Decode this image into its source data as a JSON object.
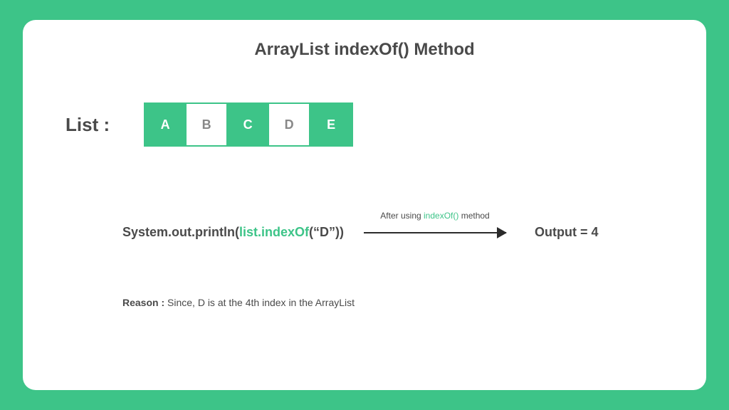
{
  "title": "ArrayList indexOf() Method",
  "list_label": "List :",
  "cells": [
    {
      "value": "A",
      "variant": "green"
    },
    {
      "value": "B",
      "variant": "white"
    },
    {
      "value": "C",
      "variant": "green"
    },
    {
      "value": "D",
      "variant": "white"
    },
    {
      "value": "E",
      "variant": "green"
    }
  ],
  "code": {
    "prefix": "System.out.println(",
    "highlight": "list.indexOf",
    "suffix": "(“D”))"
  },
  "arrow_caption": {
    "before": "After using ",
    "highlight": "indexOf()",
    "after": " method"
  },
  "output": "Output = 4",
  "reason": {
    "label": "Reason : ",
    "text": "Since, D is at the 4th index in the ArrayList"
  }
}
